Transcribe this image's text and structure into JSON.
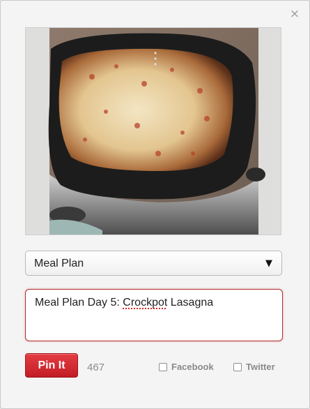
{
  "dialog": {
    "close_glyph": "×",
    "image_icon": "crockpot-lasagna-photo"
  },
  "board_select": {
    "selected": "Meal Plan",
    "arrow_glyph": "▼"
  },
  "description": {
    "text_before": "Meal Plan Day 5: ",
    "misspelled": "Crockpot",
    "text_after": " Lasagna"
  },
  "actions": {
    "pin_label": "Pin It",
    "char_count": "467",
    "facebook_label": "Facebook",
    "twitter_label": "Twitter"
  },
  "colors": {
    "pin_button": "#d12a31",
    "focus_border": "#b33030"
  }
}
